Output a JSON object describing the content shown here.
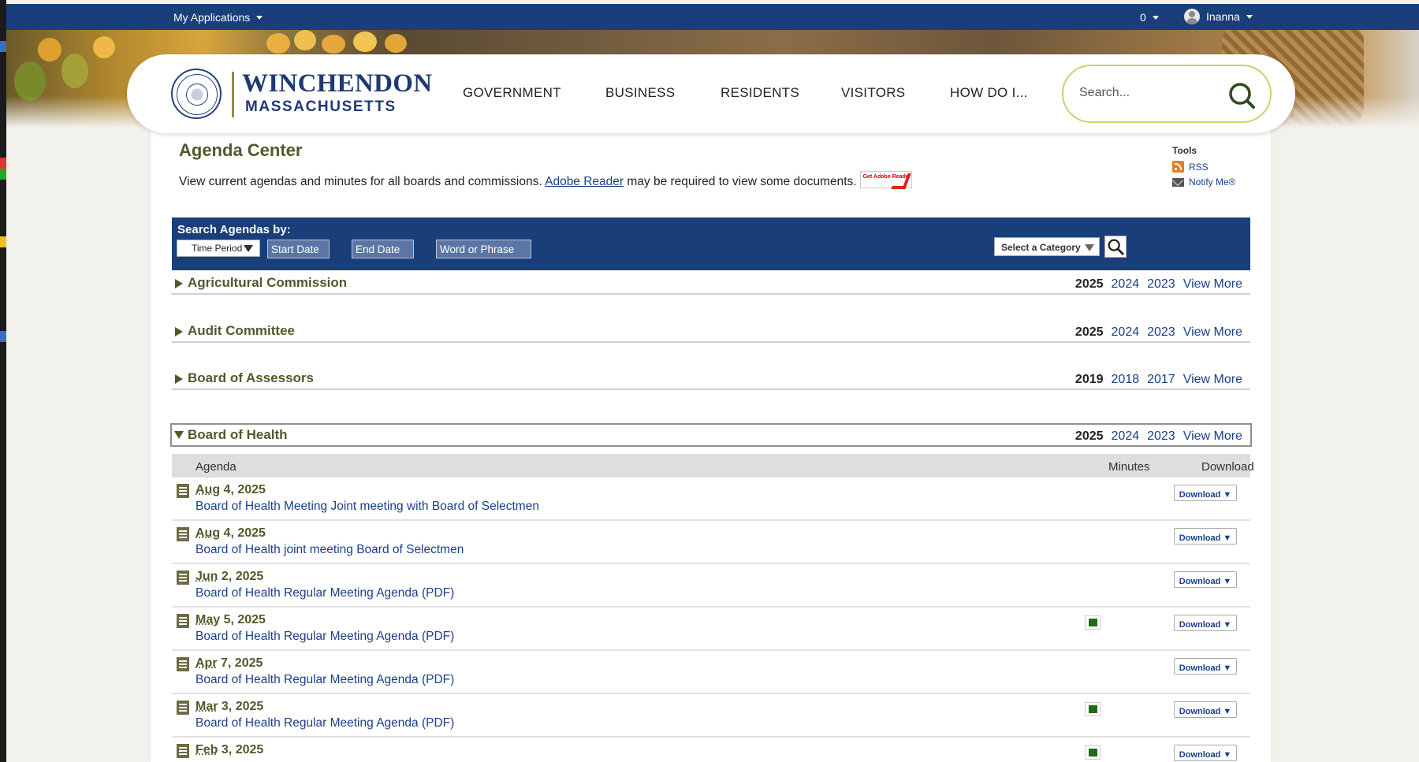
{
  "topbar": {
    "apps_label": "My Applications",
    "count": "0",
    "user_name": "Inanna"
  },
  "header": {
    "brand_line1": "WINCHENDON",
    "brand_line2": "MASSACHUSETTS",
    "nav": [
      "GOVERNMENT",
      "BUSINESS",
      "RESIDENTS",
      "VISITORS",
      "HOW DO I..."
    ],
    "search_placeholder": "Search..."
  },
  "page": {
    "title": "Agenda Center",
    "intro_before": "View current agendas and minutes for all boards and commissions. ",
    "intro_link": "Adobe Reader",
    "intro_after": " may be required to view some documents.",
    "adobe_badge": "Get Adobe Reader"
  },
  "tools": {
    "heading": "Tools",
    "rss": "RSS",
    "notify": "Notify Me®"
  },
  "search": {
    "label": "Search Agendas by:",
    "time_period": "Time Period",
    "start_date": "Start Date",
    "end_date": "End Date",
    "word": "Word or Phrase",
    "category": "Select a Category"
  },
  "categories": [
    {
      "name": "Agricultural Commission",
      "years": [
        "2025",
        "2024",
        "2023"
      ],
      "more": "View More"
    },
    {
      "name": "Audit Committee",
      "years": [
        "2025",
        "2024",
        "2023"
      ],
      "more": "View More"
    },
    {
      "name": "Board of Assessors",
      "years": [
        "2019",
        "2018",
        "2017"
      ],
      "more": "View More"
    },
    {
      "name": "Board of Health",
      "years": [
        "2025",
        "2024",
        "2023"
      ],
      "more": "View More"
    }
  ],
  "table": {
    "headers": {
      "agenda": "Agenda",
      "minutes": "Minutes",
      "download": "Download"
    },
    "download_label": "Download ▼",
    "rows": [
      {
        "month": "Aug",
        "rest": " 4, 2025",
        "title": "Board of Health Meeting Joint meeting with Board of Selectmen",
        "minutes": false
      },
      {
        "month": "Aug",
        "rest": " 4, 2025",
        "title": "Board of Health joint meeting Board of Selectmen",
        "minutes": false
      },
      {
        "month": "Jun",
        "rest": " 2, 2025",
        "title": "Board of Health Regular Meeting Agenda (PDF)",
        "minutes": false
      },
      {
        "month": "May",
        "rest": " 5, 2025",
        "title": "Board of Health Regular Meeting Agenda (PDF)",
        "minutes": true
      },
      {
        "month": "Apr",
        "rest": " 7, 2025",
        "title": "Board of Health Regular Meeting Agenda (PDF)",
        "minutes": false
      },
      {
        "month": "Mar",
        "rest": " 3, 2025",
        "title": "Board of Health Regular Meeting Agenda (PDF)",
        "minutes": true
      },
      {
        "month": "Feb",
        "rest": " 3, 2025",
        "title": "",
        "minutes": true
      }
    ]
  },
  "colors": {
    "navy": "#193e7a",
    "olive": "#4d5b2c",
    "link": "#1b3f8a",
    "accent_green": "#c8d36a"
  }
}
